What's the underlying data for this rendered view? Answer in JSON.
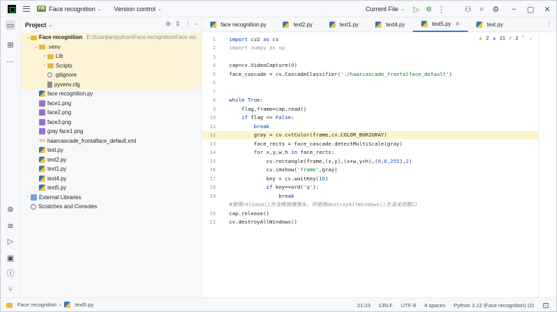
{
  "topbar": {
    "project_badge": "FR",
    "project_name": "Face recognition",
    "vcs": "Version control",
    "run_config": "Current File"
  },
  "project_panel": {
    "title": "Project",
    "tree": [
      {
        "indent": 0,
        "arrow": "⌄",
        "icon": "folder-icon",
        "label": "Face recognition",
        "hint": "E:\\Xuanjian\\python\\Face recognition\\Face rec",
        "bold": true,
        "row": "hl"
      },
      {
        "indent": 1,
        "arrow": "⌄",
        "icon": "folder-icon",
        "label": ".venv",
        "row": "hl"
      },
      {
        "indent": 2,
        "arrow": "›",
        "icon": "folder-icon",
        "label": "Lib",
        "row": "hl"
      },
      {
        "indent": 2,
        "arrow": "›",
        "icon": "folder-icon",
        "label": "Scripts",
        "row": "hl"
      },
      {
        "indent": 2,
        "arrow": "",
        "icon": "git-icon",
        "label": ".gitignore",
        "row": "hl"
      },
      {
        "indent": 2,
        "arrow": "",
        "icon": "config-icon",
        "label": "pyvenv.cfg",
        "row": "hl"
      },
      {
        "indent": 1,
        "arrow": "",
        "icon": "python-file-icon",
        "label": "face recognition.py",
        "row": ""
      },
      {
        "indent": 1,
        "arrow": "",
        "icon": "image-file-icon",
        "label": "face1.png",
        "row": ""
      },
      {
        "indent": 1,
        "arrow": "",
        "icon": "image-file-icon",
        "label": "face2.png",
        "row": ""
      },
      {
        "indent": 1,
        "arrow": "",
        "icon": "image-file-icon",
        "label": "face3.png",
        "row": ""
      },
      {
        "indent": 1,
        "arrow": "",
        "icon": "image-file-icon",
        "label": "gray face1.png",
        "row": ""
      },
      {
        "indent": 1,
        "arrow": "",
        "icon": "xml-file-icon",
        "label": "haarcascade_frontalface_default.xml",
        "row": ""
      },
      {
        "indent": 1,
        "arrow": "",
        "icon": "python-file-icon",
        "label": "test.py",
        "row": ""
      },
      {
        "indent": 1,
        "arrow": "",
        "icon": "python-file-icon",
        "label": "text2.py",
        "row": ""
      },
      {
        "indent": 1,
        "arrow": "",
        "icon": "python-file-icon",
        "label": "text1.py",
        "row": ""
      },
      {
        "indent": 1,
        "arrow": "",
        "icon": "python-file-icon",
        "label": "text4.py",
        "row": ""
      },
      {
        "indent": 1,
        "arrow": "",
        "icon": "python-file-icon",
        "label": "text5.py",
        "row": ""
      },
      {
        "indent": 0,
        "arrow": "›",
        "icon": "library-icon",
        "label": "External Libraries",
        "row": ""
      },
      {
        "indent": 0,
        "arrow": "",
        "icon": "scratches-icon",
        "label": "Scratches and Consoles",
        "row": ""
      }
    ]
  },
  "tabs": [
    {
      "label": "face recognition.py",
      "active": false
    },
    {
      "label": "text2.py",
      "active": false
    },
    {
      "label": "text1.py",
      "active": false
    },
    {
      "label": "text4.py",
      "active": false
    },
    {
      "label": "text5.py",
      "active": true
    },
    {
      "label": "text.py",
      "active": false
    }
  ],
  "inspections": {
    "warnings": "2",
    "weak": "21",
    "ok": "2"
  },
  "editor": {
    "lines": [
      {
        "n": "1",
        "html": "<span class='kw'>import</span> cv2 <span class='kw'>as</span> cv"
      },
      {
        "n": "2",
        "html": "<span class='imp'>import numpy as np</span>"
      },
      {
        "n": "3",
        "html": ""
      },
      {
        "n": "4",
        "html": "cap=cv.VideoCapture(<span class='num'>0</span>)"
      },
      {
        "n": "5",
        "html": "face_cascade = cv.CascadeClassifier(<span class='str'>'./haarcascade_frontalface_default'</span>)"
      },
      {
        "n": "6",
        "html": ""
      },
      {
        "n": "7",
        "html": ""
      },
      {
        "n": "8",
        "html": "<span class='kw'>while True</span>:"
      },
      {
        "n": "9",
        "html": "    flag,frame=cap.read()"
      },
      {
        "n": "10",
        "html": "    <span class='kw'>if</span> flag == <span class='kw'>False</span>:"
      },
      {
        "n": "11",
        "html": "        <span class='kw'>break</span>"
      },
      {
        "n": "12",
        "html": "        gray = cv.cvtColor(frame,cv.COLOR_BGR2GRAY)",
        "hl": true
      },
      {
        "n": "13",
        "html": "        face_rects = face_cascade.detectMultiScale(gray)"
      },
      {
        "n": "14",
        "html": "        <span class='kw'>for</span> x,y,w,h <span class='kw'>in</span> face_rects:"
      },
      {
        "n": "15",
        "html": "            cv.rectangle(frame,(x,y),(x+w,y+h),(<span class='num'>0</span>,<span class='num'>0</span>,<span class='num'>255</span>),<span class='num'>2</span>)"
      },
      {
        "n": "16",
        "html": "            cv.imshow(<span class='str'>'frame'</span>,gray)"
      },
      {
        "n": "17",
        "html": "            key = cv.waitKey(<span class='num'>10</span>)"
      },
      {
        "n": "18",
        "html": "            <span class='kw'>if</span> key==ord(<span class='str'>'q'</span>):"
      },
      {
        "n": "19",
        "html": "                <span class='kw'>break</span>"
      },
      {
        "n": "",
        "html": "<span class='cm'>#使用release()方法释放摄像头，并使用destroyAllWindows()方法关闭窗口</span>"
      },
      {
        "n": "20",
        "html": "cap.release()"
      },
      {
        "n": "21",
        "html": "cv.destroyAllWindows()"
      }
    ]
  },
  "statusbar": {
    "crumb_project": "Face recognition",
    "crumb_file": "text5.py",
    "position": "21:23",
    "line_sep": "CRLF",
    "encoding": "UTF-8",
    "indent": "4 spaces",
    "interpreter": "Python 3.12 (Face recognition) (2)"
  }
}
